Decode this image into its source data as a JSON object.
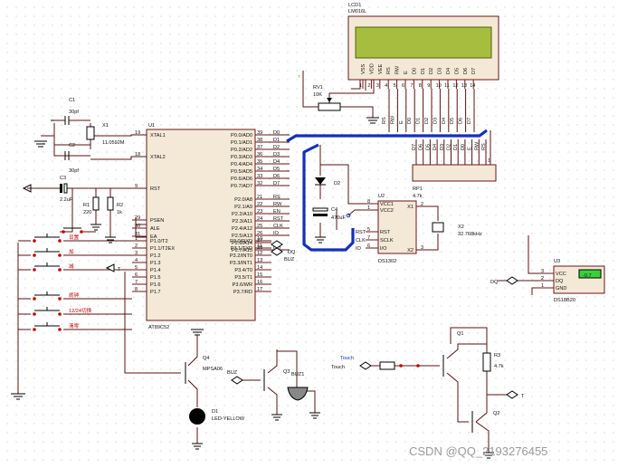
{
  "watermark": "CSDN @QQ_2193276455",
  "lcd": {
    "ref": "LCD1",
    "part": "LM016L",
    "pins": [
      "VSS",
      "VDD",
      "VEE",
      "RS",
      "RW",
      "E",
      "D0",
      "D1",
      "D2",
      "D3",
      "D4",
      "D5",
      "D6",
      "D7"
    ],
    "pin_nums": [
      "1",
      "2",
      "3",
      "4",
      "5",
      "6",
      "7",
      "8",
      "9",
      "10",
      "11",
      "12",
      "13",
      "14"
    ]
  },
  "rv1": {
    "ref": "RV1",
    "value": "10K"
  },
  "rp1": {
    "ref": "RP1",
    "value": "4.7k",
    "pin": "1"
  },
  "bus_labels": [
    "RS",
    "RW",
    "E",
    "D0",
    "D1",
    "D2",
    "D3",
    "D4",
    "D5",
    "D6",
    "D7"
  ],
  "bus_labels_bot": [
    "D7",
    "D6",
    "D5",
    "D4",
    "D3",
    "D2",
    "D1",
    "D0",
    "E",
    "RW",
    "RS"
  ],
  "c1": {
    "ref": "C1",
    "value": "30pf"
  },
  "c2": {
    "ref": "C2",
    "value": "30pf"
  },
  "x1": {
    "ref": "X1",
    "value": "11.0592M"
  },
  "c3": {
    "ref": "C3",
    "value": "2.2uF"
  },
  "r1": {
    "ref": "R1",
    "value": "220"
  },
  "r2": {
    "ref": "R2",
    "value": "1k"
  },
  "u1": {
    "ref": "U1",
    "part": "AT89C52",
    "left_pins": [
      {
        "num": "19",
        "name": "XTAL1"
      },
      {
        "num": "18",
        "name": "XTAL2"
      },
      {
        "num": "9",
        "name": "RST"
      },
      {
        "num": "29",
        "name": "PSEN"
      },
      {
        "num": "30",
        "name": "ALE"
      },
      {
        "num": "31",
        "name": "EA"
      },
      {
        "num": "1",
        "name": "P1.0/T2"
      },
      {
        "num": "2",
        "name": "P1.1/T2EX"
      },
      {
        "num": "3",
        "name": "P1.2"
      },
      {
        "num": "4",
        "name": "P1.3"
      },
      {
        "num": "5",
        "name": "P1.4"
      },
      {
        "num": "6",
        "name": "P1.5"
      },
      {
        "num": "7",
        "name": "P1.6"
      },
      {
        "num": "8",
        "name": "P1.7"
      }
    ],
    "right_pins": [
      {
        "num": "39",
        "name": "P0.0/AD0",
        "net": "D0"
      },
      {
        "num": "38",
        "name": "P0.1/AD1",
        "net": "D1"
      },
      {
        "num": "37",
        "name": "P0.2/AD2",
        "net": "D2"
      },
      {
        "num": "36",
        "name": "P0.3/AD3",
        "net": "D3"
      },
      {
        "num": "35",
        "name": "P0.4/AD4",
        "net": "D4"
      },
      {
        "num": "34",
        "name": "P0.5/AD5",
        "net": "D5"
      },
      {
        "num": "33",
        "name": "P0.6/AD6",
        "net": "D6"
      },
      {
        "num": "32",
        "name": "P0.7/AD7",
        "net": "D7"
      },
      {
        "num": "21",
        "name": "P2.0/A8",
        "net": "RS"
      },
      {
        "num": "22",
        "name": "P2.1/A9",
        "net": "RW"
      },
      {
        "num": "23",
        "name": "P2.2/A10",
        "net": "EN"
      },
      {
        "num": "24",
        "name": "P2.3/A11",
        "net": "RST"
      },
      {
        "num": "25",
        "name": "P2.4/A12",
        "net": "CLK"
      },
      {
        "num": "26",
        "name": "P2.5/A13",
        "net": "IO"
      },
      {
        "num": "27",
        "name": "P2.6/A14",
        "net": ""
      },
      {
        "num": "28",
        "name": "P2.7/A15",
        "net": "DQ"
      },
      {
        "num": "10",
        "name": "P3.0/RXD",
        "net": ""
      },
      {
        "num": "11",
        "name": "P3.1/TXD",
        "net": ""
      },
      {
        "num": "12",
        "name": "P3.2/INT0",
        "net": ""
      },
      {
        "num": "13",
        "name": "P3.3/INT1",
        "net": ""
      },
      {
        "num": "14",
        "name": "P3.4/T0",
        "net": ""
      },
      {
        "num": "15",
        "name": "P3.5/T1",
        "net": ""
      },
      {
        "num": "16",
        "name": "P3.6/WR",
        "net": ""
      },
      {
        "num": "17",
        "name": "P3.7/RD",
        "net": ""
      }
    ]
  },
  "buttons": [
    "设置",
    "加",
    "减",
    "闹钟",
    "12/24切换",
    "清零"
  ],
  "t_label": "T",
  "buz_label": "BUZ",
  "dq_label": "DQ",
  "d2": {
    "ref": "D2"
  },
  "c4": {
    "ref": "C4",
    "value": "470uF"
  },
  "u2": {
    "ref": "U2",
    "part": "DS1302",
    "pins": [
      {
        "num": "8",
        "name": "VCC1"
      },
      {
        "num": "1",
        "name": "VCC2"
      },
      {
        "num": "5",
        "name": "RST"
      },
      {
        "num": "7",
        "name": "SCLK"
      },
      {
        "num": "6",
        "name": "I/O"
      },
      {
        "num": "2",
        "name": "X1"
      },
      {
        "num": "3",
        "name": "X2"
      }
    ],
    "nets": [
      "RST",
      "CLK",
      "IO"
    ]
  },
  "x2": {
    "ref": "X2",
    "value": "32.768kHz"
  },
  "u3": {
    "ref": "U3",
    "part": "DS18B20",
    "pins": [
      {
        "num": "3",
        "name": "VCC"
      },
      {
        "num": "2",
        "name": "DQ"
      },
      {
        "num": "1",
        "name": "GND"
      }
    ],
    "display": "-0.7"
  },
  "q4": {
    "ref": "Q4",
    "part": "MPSA06"
  },
  "d1": {
    "ref": "D1",
    "part": "LED-YELLOW"
  },
  "q3": {
    "ref": "Q3"
  },
  "buz1": {
    "ref": "BUZ1"
  },
  "touch": {
    "label": "Touch",
    "net": "Touch"
  },
  "q1": {
    "ref": "Q1"
  },
  "q2": {
    "ref": "Q2"
  },
  "r3": {
    "ref": "R3",
    "value": "4.7k"
  }
}
